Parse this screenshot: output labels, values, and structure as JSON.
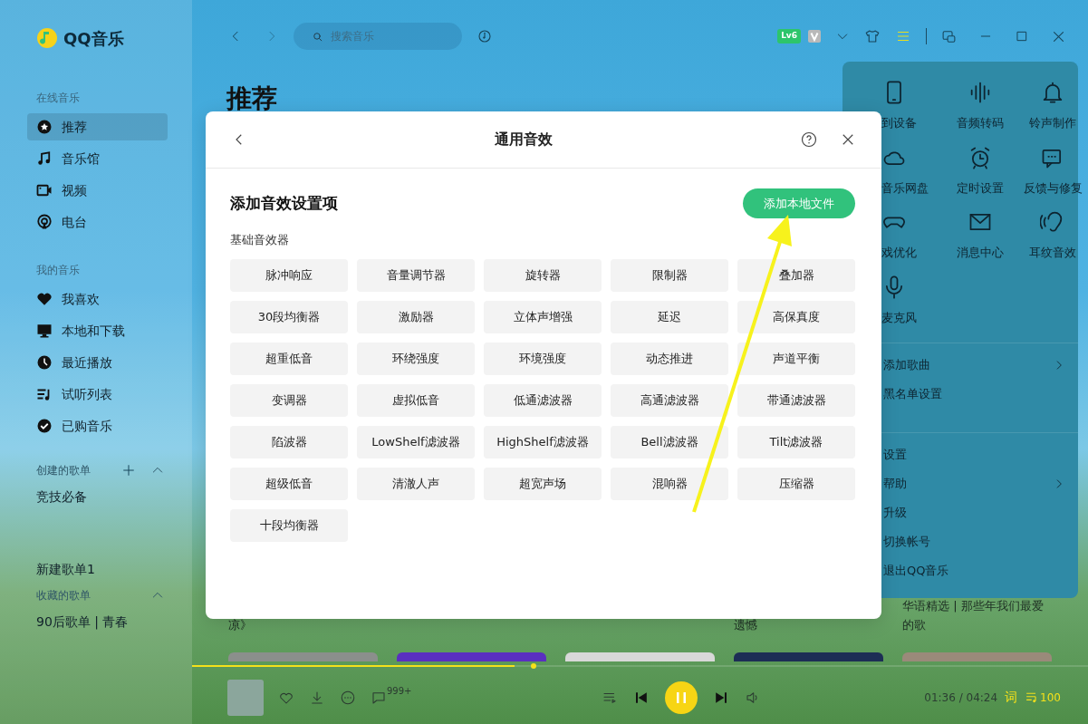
{
  "app": {
    "logo_text": "QQ音乐"
  },
  "sidebar": {
    "sections": [
      {
        "title": "在线音乐",
        "items": [
          {
            "label": "推荐",
            "selected": true
          },
          {
            "label": "音乐馆",
            "selected": false
          },
          {
            "label": "视频",
            "selected": false
          },
          {
            "label": "电台",
            "selected": false
          }
        ]
      },
      {
        "title": "我的音乐",
        "items": [
          {
            "label": "我喜欢",
            "selected": false
          },
          {
            "label": "本地和下载",
            "selected": false
          },
          {
            "label": "最近播放",
            "selected": false
          },
          {
            "label": "试听列表",
            "selected": false
          },
          {
            "label": "已购音乐",
            "selected": false
          }
        ]
      }
    ],
    "playlist_groups": [
      {
        "title": "创建的歌单",
        "can_add": true,
        "expanded": true,
        "items": [
          "竞技必备",
          "新建歌单1"
        ]
      },
      {
        "title": "收藏的歌单",
        "can_add": false,
        "expanded": true,
        "items": [
          "90后歌单 | 青春"
        ]
      }
    ]
  },
  "topbar": {
    "search": {
      "placeholder": "搜索音乐"
    },
    "level_badge": "Lv6"
  },
  "page_title": "推荐",
  "cards": {
    "leading": [
      {
        "caption": [
          "凉》"
        ]
      }
    ],
    "trailing": [
      {
        "caption": [
          "遗憾"
        ]
      },
      {
        "caption": [
          "华语精选 | 那些年我们最爱",
          "的歌"
        ]
      }
    ]
  },
  "dialog": {
    "title": "通用音效",
    "heading": "添加音效设置项",
    "add_button": "添加本地文件",
    "group_label": "基础音效器",
    "effects": [
      "脉冲响应",
      "音量调节器",
      "旋转器",
      "限制器",
      "叠加器",
      "30段均衡器",
      "激励器",
      "立体声增强",
      "延迟",
      "高保真度",
      "超重低音",
      "环绕强度",
      "环境强度",
      "动态推进",
      "声道平衡",
      "变调器",
      "虚拟低音",
      "低通滤波器",
      "高通滤波器",
      "带通滤波器",
      "陷波器",
      "LowShelf滤波器",
      "HighShelf滤波器",
      "Bell滤波器",
      "Tilt滤波器",
      "超级低音",
      "清澈人声",
      "超宽声场",
      "混响器",
      "压缩器",
      "十段均衡器"
    ]
  },
  "menu": {
    "tools": [
      "到设备",
      "音频转码",
      "铃声制作",
      "音乐网盘",
      "定时设置",
      "反馈与修复",
      "戏优化",
      "消息中心",
      "耳纹音效",
      "麦克风"
    ],
    "groups": [
      {
        "items": [
          {
            "label": "添加歌曲",
            "submenu": true
          },
          {
            "label": "黑名单设置",
            "submenu": false
          }
        ]
      },
      {
        "items": [
          {
            "label": "设置",
            "submenu": false
          },
          {
            "label": "帮助",
            "submenu": true
          },
          {
            "label": "升级",
            "submenu": false
          },
          {
            "label": "切换帐号",
            "submenu": false
          },
          {
            "label": "退出QQ音乐",
            "submenu": false
          }
        ]
      }
    ]
  },
  "player": {
    "progress": {
      "level": 0.36
    },
    "playing": true,
    "comment_count": "999+",
    "time": "01:36 / 04:24",
    "lyrics_button": "词",
    "playlist_count": "100"
  },
  "overlay": {
    "arrow": true
  }
}
